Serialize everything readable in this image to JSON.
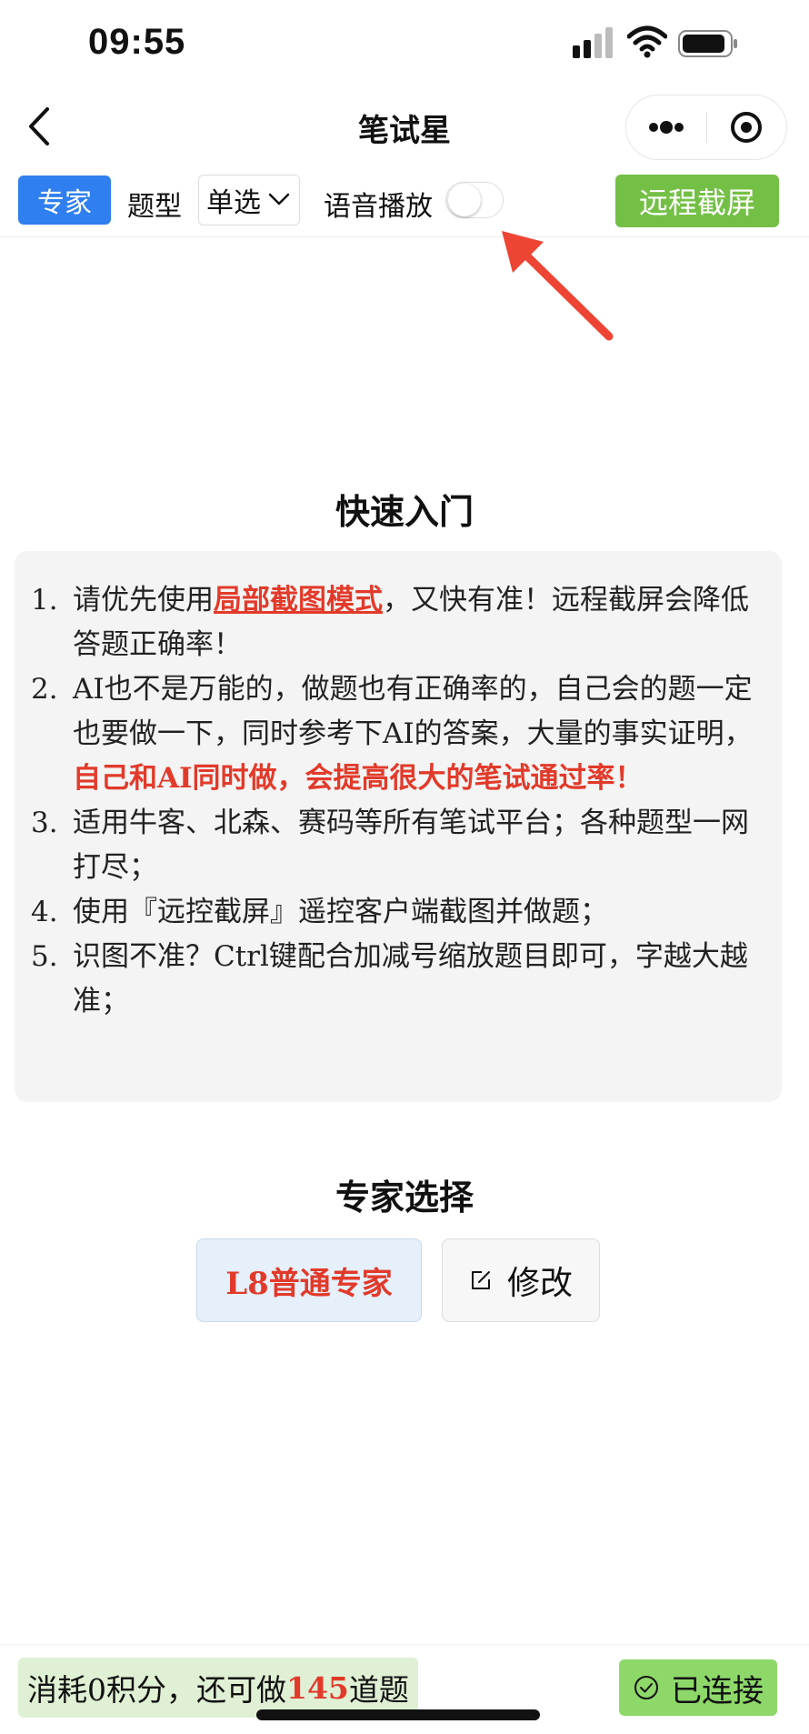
{
  "status_bar": {
    "time": "09:55"
  },
  "nav": {
    "title": "笔试星"
  },
  "toolbar": {
    "expert_label": "专家",
    "qtype_label": "题型",
    "qtype_value": "单选",
    "voice_label": "语音播放",
    "voice_enabled": false,
    "remote_label": "远程截屏"
  },
  "quick_start": {
    "title": "快速入门",
    "items": [
      {
        "num": "1.",
        "pre": "请优先使用",
        "link": "局部截图模式",
        "post": "，又快有准！远程截屏会降低答题正确率！"
      },
      {
        "num": "2.",
        "pre": "AI也不是万能的，做题也有正确率的，自己会的题一定也要做一下，同时参考下AI的答案，大量的事实证明，",
        "bold": "自己和AI同时做，会提高很大的笔试通过率！"
      },
      {
        "num": "3.",
        "text": "适用牛客、北森、赛码等所有笔试平台；各种题型一网打尽；"
      },
      {
        "num": "4.",
        "text": "使用『远控截屏』遥控客户端截图并做题；"
      },
      {
        "num": "5.",
        "text": "识图不准？Ctrl键配合加减号缩放题目即可，字越大越准；"
      }
    ]
  },
  "expert_select": {
    "title": "专家选择",
    "current": "L8普通专家",
    "edit_label": "修改"
  },
  "bottom": {
    "points_pre": "消耗0积分，还可做",
    "points_count": "145",
    "points_post": "道题",
    "connected_label": "已连接"
  },
  "colors": {
    "primary_blue": "#2f7ff0",
    "remote_green": "#74c046",
    "highlight_red": "#e23a2a",
    "connected_green": "#8ed86a"
  }
}
